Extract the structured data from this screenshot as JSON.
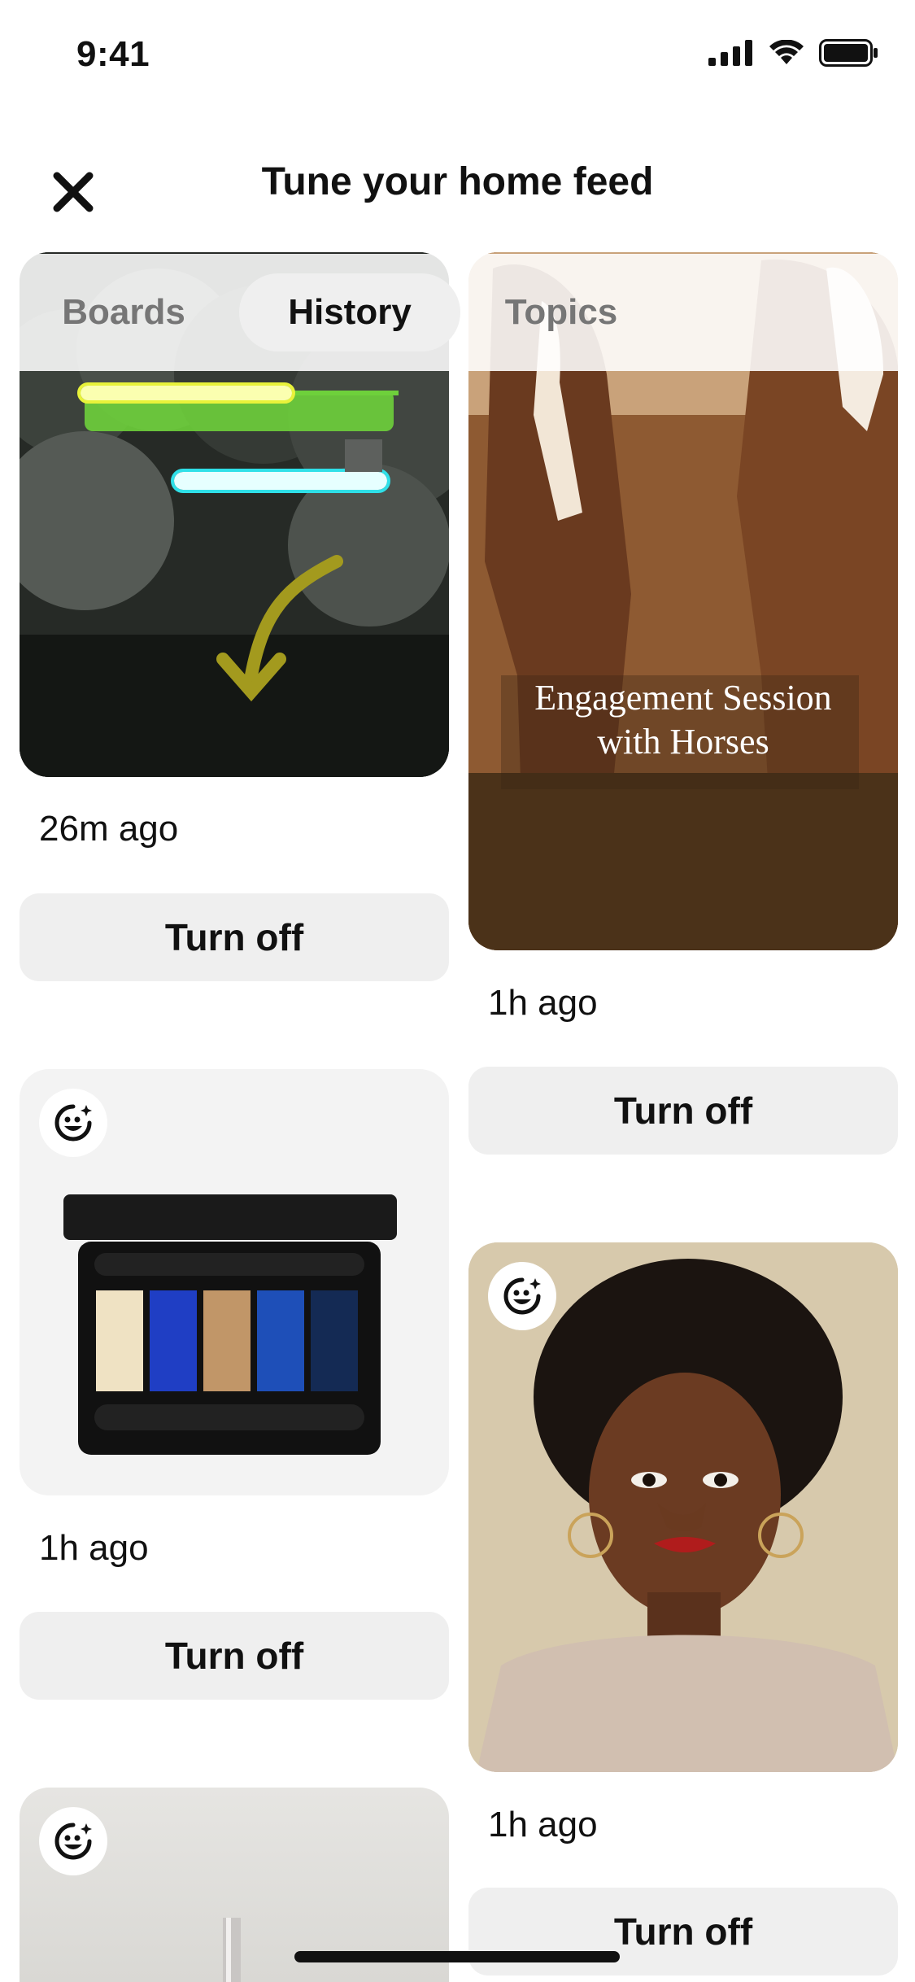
{
  "status": {
    "time": "9:41"
  },
  "header": {
    "title": "Tune your home feed"
  },
  "tabs": [
    {
      "label": "Boards"
    },
    {
      "label": "History"
    },
    {
      "label": "Topics"
    }
  ],
  "pins": [
    {
      "time": "26m ago",
      "action": "Turn off"
    },
    {
      "overlay_line1": "Engagement Session",
      "overlay_line2": "with Horses",
      "time": "1h ago",
      "action": "Turn off"
    },
    {
      "time": "1h ago",
      "action": "Turn off"
    },
    {
      "time": "1h ago",
      "action": "Turn off"
    },
    {
      "time": "",
      "action": ""
    }
  ],
  "icons": {
    "close": "close-icon",
    "badge": "sparkle-face-icon",
    "signal": "cellular-signal-icon",
    "wifi": "wifi-icon",
    "battery": "battery-icon"
  }
}
